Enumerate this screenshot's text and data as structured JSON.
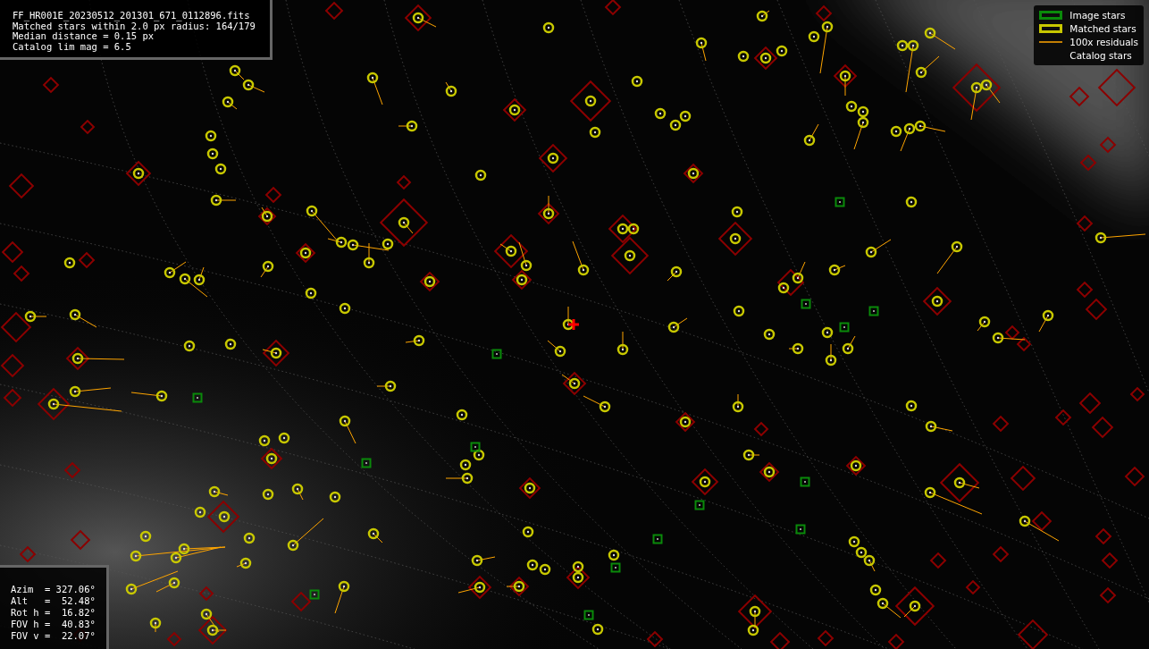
{
  "info_box": {
    "lines": [
      "FF_HR001E_20230512_201301_671_0112896.fits",
      "Matched stars within 2.0 px radius: 164/179",
      "Median distance = 0.15 px",
      "Catalog lim mag = 6.5"
    ]
  },
  "legend": {
    "items": [
      {
        "kind": "image",
        "label": "Image stars"
      },
      {
        "kind": "matched",
        "label": "Matched stars"
      },
      {
        "kind": "residual",
        "label": "100x residuals"
      },
      {
        "kind": "catalog",
        "label": "Catalog stars"
      }
    ]
  },
  "pointing_box": {
    "lines": [
      "Azim  = 327.06°",
      "Alt   =  52.48°",
      "Rot h =  16.82°",
      "FOV h =  40.83°",
      "FOV v =  22.07°"
    ]
  }
}
